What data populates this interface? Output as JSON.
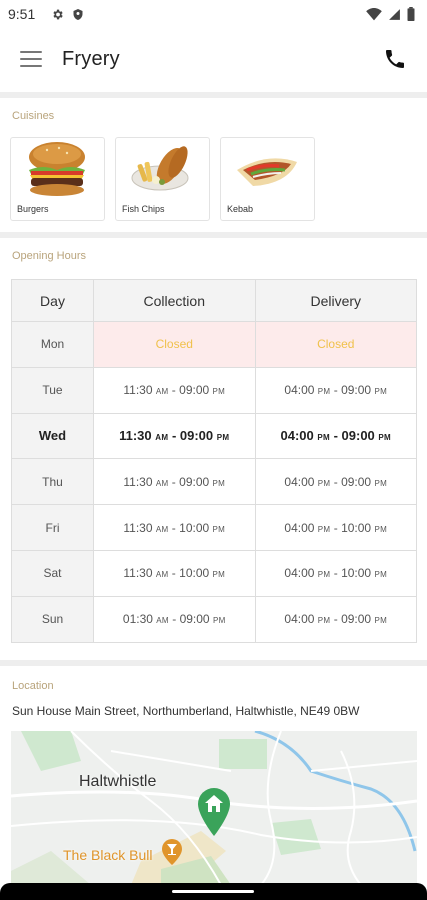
{
  "status_bar": {
    "time": "9:51"
  },
  "app_bar": {
    "title": "Fryery"
  },
  "cuisines": {
    "label": "Cuisines",
    "items": [
      {
        "name": "Burgers"
      },
      {
        "name": "Fish  Chips"
      },
      {
        "name": "Kebab"
      }
    ]
  },
  "opening_hours": {
    "label": "Opening Hours",
    "headers": {
      "day": "Day",
      "collection": "Collection",
      "delivery": "Delivery"
    },
    "rows": [
      {
        "day": "Mon",
        "collection": "Closed",
        "delivery": "Closed"
      },
      {
        "day": "Tue",
        "collection": {
          "open": "11:30",
          "open_period": "AM",
          "close": "09:00",
          "close_period": "PM"
        },
        "delivery": {
          "open": "04:00",
          "open_period": "PM",
          "close": "09:00",
          "close_period": "PM"
        }
      },
      {
        "day": "Wed",
        "collection": {
          "open": "11:30",
          "open_period": "AM",
          "close": "09:00",
          "close_period": "PM"
        },
        "delivery": {
          "open": "04:00",
          "open_period": "PM",
          "close": "09:00",
          "close_period": "PM"
        }
      },
      {
        "day": "Thu",
        "collection": {
          "open": "11:30",
          "open_period": "AM",
          "close": "09:00",
          "close_period": "PM"
        },
        "delivery": {
          "open": "04:00",
          "open_period": "PM",
          "close": "09:00",
          "close_period": "PM"
        }
      },
      {
        "day": "Fri",
        "collection": {
          "open": "11:30",
          "open_period": "AM",
          "close": "10:00",
          "close_period": "PM"
        },
        "delivery": {
          "open": "04:00",
          "open_period": "PM",
          "close": "10:00",
          "close_period": "PM"
        }
      },
      {
        "day": "Sat",
        "collection": {
          "open": "11:30",
          "open_period": "AM",
          "close": "10:00",
          "close_period": "PM"
        },
        "delivery": {
          "open": "04:00",
          "open_period": "PM",
          "close": "10:00",
          "close_period": "PM"
        }
      },
      {
        "day": "Sun",
        "collection": {
          "open": "01:30",
          "open_period": "AM",
          "close": "09:00",
          "close_period": "PM"
        },
        "delivery": {
          "open": "04:00",
          "open_period": "PM",
          "close": "09:00",
          "close_period": "PM"
        }
      }
    ],
    "separator": " - "
  },
  "location": {
    "label": "Location",
    "address": "Sun House Main Street, Northumberland, Haltwhistle, NE49 0BW",
    "map": {
      "town_label": "Haltwhistle",
      "poi_label": "The Black Bull"
    }
  },
  "colors": {
    "section_label": "#b9a47c",
    "closed_text": "#f0c14b",
    "closed_bg": "#fdebeb",
    "map_pin": "#3aa35a",
    "poi": "#e0952b"
  }
}
